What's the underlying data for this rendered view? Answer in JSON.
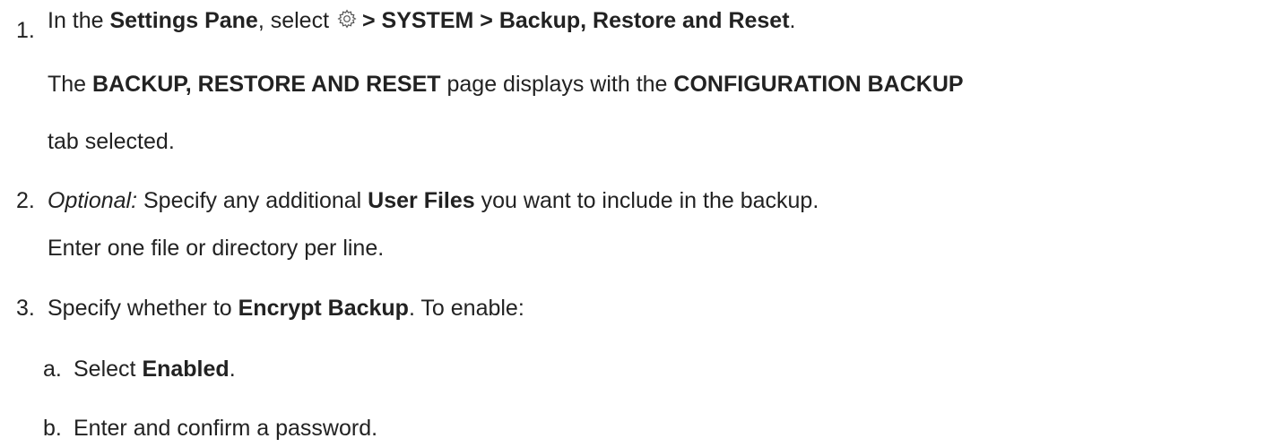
{
  "steps": [
    {
      "number": "1.",
      "parts": {
        "p1": "In the ",
        "b1": "Settings Pane",
        "p2": ", select ",
        "icon": "gear-icon",
        "b2": "> SYSTEM > Backup, Restore and Reset",
        "p3": "."
      },
      "note": {
        "p1": "The ",
        "b1": "BACKUP, RESTORE AND RESET",
        "p2": " page displays with the ",
        "b2": "CONFIGURATION BACKUP",
        "p3": "tab selected."
      }
    },
    {
      "number": "2.",
      "parts": {
        "i1": "Optional:",
        "p1": " Specify any additional ",
        "b1": "User Files",
        "p2": " you want to include in the backup."
      },
      "note": "Enter one file or directory per line."
    },
    {
      "number": "3.",
      "parts": {
        "p1": "Specify whether to ",
        "b1": "Encrypt Backup",
        "p2": ". To enable:"
      },
      "substeps": [
        {
          "letter": "a.",
          "p1": "Select ",
          "b1": "Enabled",
          "p2": "."
        },
        {
          "letter": "b.",
          "p1": "Enter and confirm a password."
        }
      ]
    }
  ]
}
